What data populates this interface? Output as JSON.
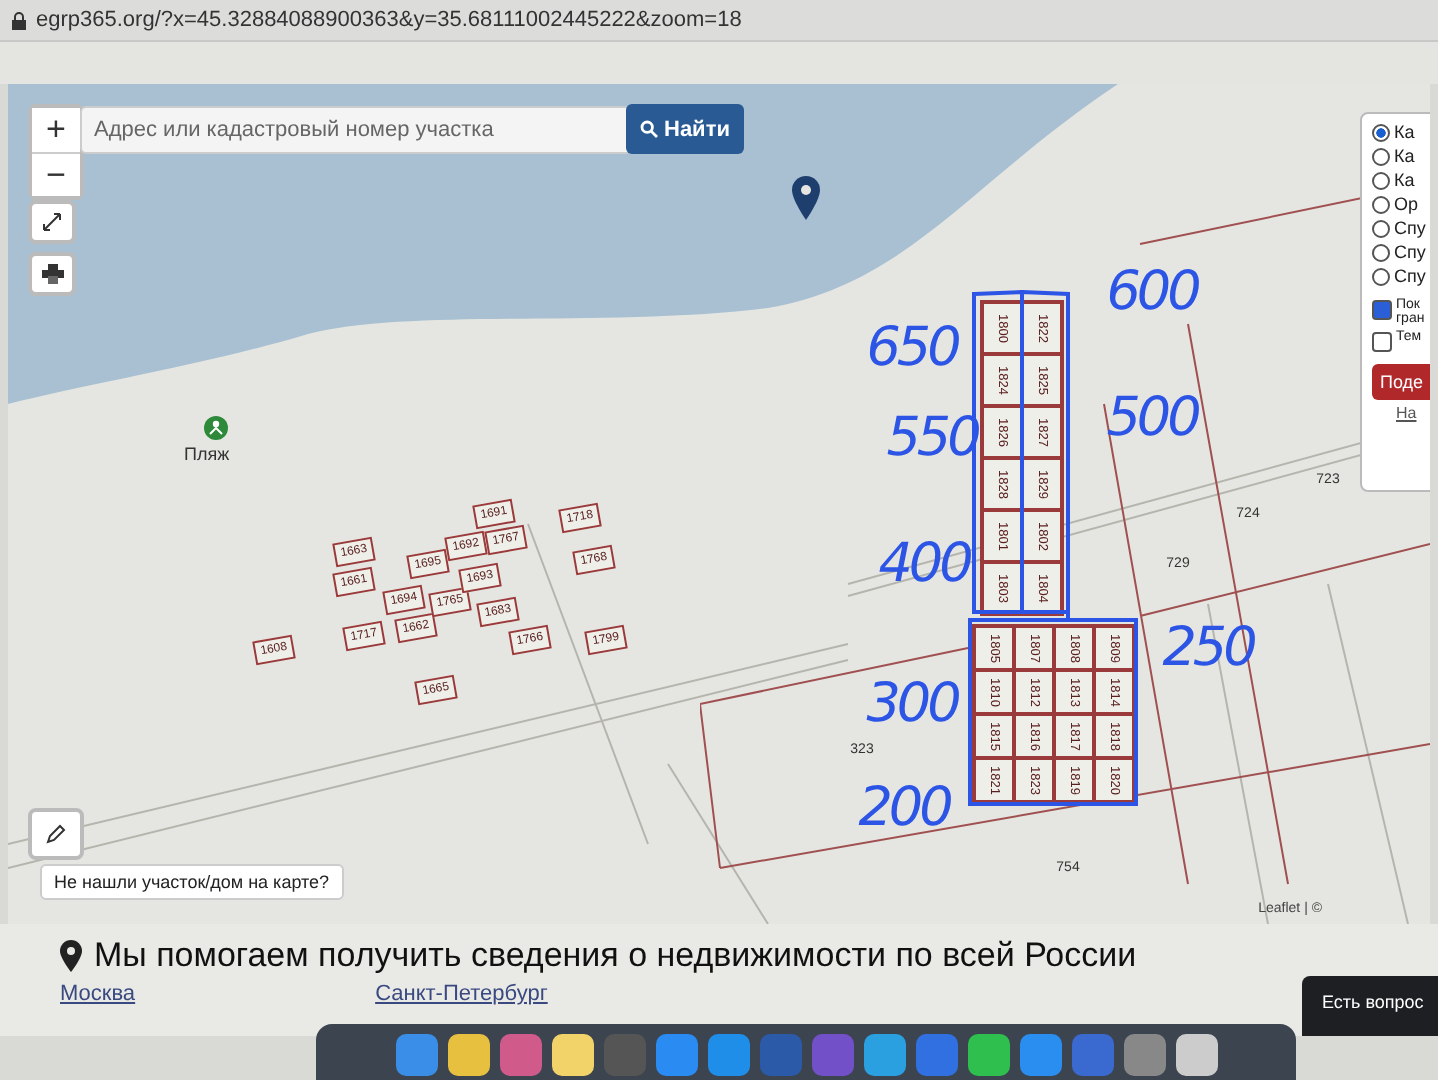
{
  "address_bar": {
    "url": "egrp365.org/?x=45.32884088900363&y=35.68111002445222&zoom=18"
  },
  "map": {
    "search": {
      "placeholder": "Адрес или кадастровый номер участка",
      "button": "Найти"
    },
    "zoom_in": "+",
    "zoom_out": "−",
    "beach_label": "Пляж",
    "left_parcels": [
      "1663",
      "1661",
      "1608",
      "1717",
      "1694",
      "1662",
      "1695",
      "1765",
      "1692",
      "1693",
      "1683",
      "1691",
      "1767",
      "1718",
      "1768",
      "1766",
      "1799",
      "1665"
    ],
    "right_parcels": [
      "1800",
      "1822",
      "1824",
      "1825",
      "1826",
      "1827",
      "1828",
      "1829",
      "1801",
      "1802",
      "1803",
      "1804",
      "1805",
      "1807",
      "1808",
      "1809",
      "1810",
      "1812",
      "1813",
      "1814",
      "1815",
      "1816",
      "1817",
      "1818",
      "1821",
      "1823",
      "1819",
      "1820"
    ],
    "large_parcels": [
      "729",
      "724",
      "723",
      "323",
      "754"
    ],
    "annotations": [
      "650",
      "600",
      "550",
      "500",
      "400",
      "250",
      "300",
      "200"
    ],
    "layers": [
      {
        "label": "Ка",
        "selected": true
      },
      {
        "label": "Ка",
        "selected": false
      },
      {
        "label": "Ка",
        "selected": false
      },
      {
        "label": "Ор",
        "selected": false
      },
      {
        "label": "Спу",
        "selected": false
      },
      {
        "label": "Спу",
        "selected": false
      },
      {
        "label": "Спу",
        "selected": false
      }
    ],
    "options": [
      {
        "label": "Пок гран",
        "checked": true
      },
      {
        "label": "Тем",
        "checked": false
      }
    ],
    "panel_button": "Поде",
    "panel_link": "На",
    "help_tooltip": "Не нашли участок/дом на карте?",
    "attribution": "Leaflet | ©"
  },
  "info": {
    "heading": "Мы помогаем получить сведения о недвижимости по всей России",
    "links": [
      "Москва",
      "Санкт-Петербург"
    ]
  },
  "chat": {
    "label": "Есть вопрос"
  }
}
